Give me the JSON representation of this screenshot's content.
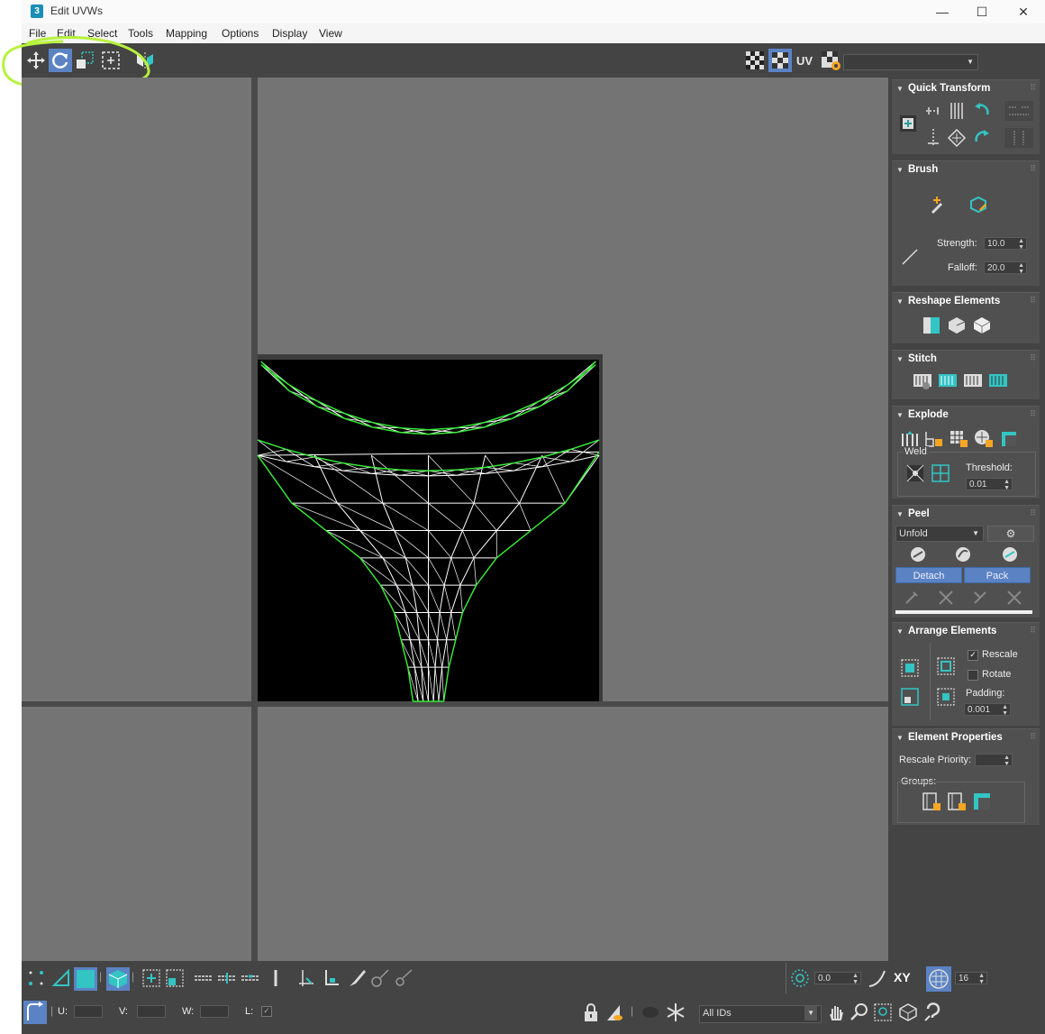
{
  "window": {
    "title": "Edit UVWs",
    "app_icon": "3",
    "minimize": "—",
    "maximize": "☐",
    "close": "✕"
  },
  "menu": [
    "File",
    "Edit",
    "Select",
    "Tools",
    "Mapping",
    "Options",
    "Display",
    "View"
  ],
  "toolbar": {
    "uv_label": "UV",
    "texture_dropdown": ""
  },
  "colors": {
    "panel_bg": "#444444",
    "viewport_bg": "#747474",
    "accent_teal": "#33c4c4",
    "selection_green": "#33ee33",
    "highlight_circle": "#b7f23c",
    "button_blue": "#5b83c4"
  },
  "quick_transform": {
    "title": "Quick Transform"
  },
  "brush": {
    "title": "Brush",
    "strength_label": "Strength:",
    "strength_value": "10.0",
    "falloff_label": "Falloff:",
    "falloff_value": "20.0"
  },
  "reshape": {
    "title": "Reshape Elements"
  },
  "stitch": {
    "title": "Stitch"
  },
  "explode": {
    "title": "Explode",
    "weld_label": "Weld",
    "threshold_label": "Threshold:",
    "threshold_value": "0.01"
  },
  "peel": {
    "title": "Peel",
    "mode": "Unfold",
    "detach_label": "Detach",
    "pack_label": "Pack"
  },
  "arrange": {
    "title": "Arrange Elements",
    "rescale_label": "Rescale",
    "rescale_checked": true,
    "rotate_label": "Rotate",
    "rotate_checked": false,
    "padding_label": "Padding:",
    "padding_value": "0.001"
  },
  "element_props": {
    "title": "Element Properties",
    "rescale_priority_label": "Rescale Priority:",
    "groups_label": "Groups:"
  },
  "bottom": {
    "angle_value": "0.0",
    "xy_label": "XY",
    "grid_value": "16",
    "u_label": "U:",
    "v_label": "V:",
    "w_label": "W:",
    "l_label": "L:",
    "ids_dropdown": "All IDs"
  }
}
